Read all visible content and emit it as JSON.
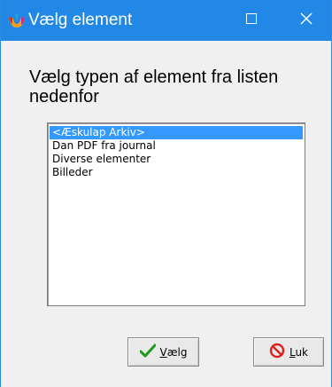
{
  "window": {
    "title": "Vælg element",
    "icon": "eskulap-app-icon",
    "controls": {
      "maximize_icon": "maximize-icon",
      "close_icon": "close-icon"
    }
  },
  "dialog": {
    "prompt_line1": "Vælg typen af element fra listen",
    "prompt_line2": "nedenfor"
  },
  "list": {
    "items": [
      {
        "label": "<Æskulap Arkiv>",
        "selected": true
      },
      {
        "label": "Dan PDF fra journal",
        "selected": false
      },
      {
        "label": "Diverse elementer",
        "selected": false
      },
      {
        "label": "Billeder",
        "selected": false
      }
    ]
  },
  "buttons": {
    "choose_label": "Vælg",
    "choose_icon": "checkmark-icon",
    "close_label": "Luk",
    "close_icon": "prohibited-icon"
  },
  "colors": {
    "titlebar": "#2288e6",
    "selection": "#3399ff",
    "dialog_bg": "#f0f0f0",
    "check_green": "#1a9a1a",
    "prohibit_red": "#e0201c"
  }
}
